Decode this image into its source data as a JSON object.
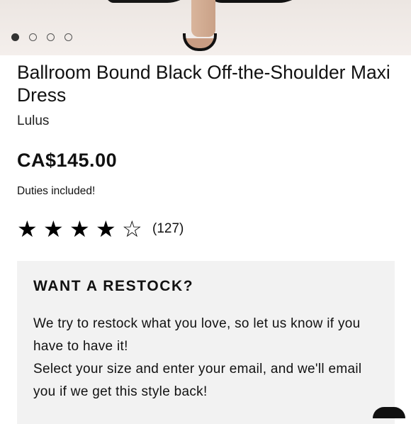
{
  "gallery": {
    "slides": [
      {
        "icon": "slide-dot-active"
      },
      {
        "icon": "slide-dot"
      },
      {
        "icon": "slide-dot"
      },
      {
        "icon": "slide-dot"
      }
    ],
    "active_index": 0
  },
  "product": {
    "title": "Ballroom Bound Black Off-the-Shoulder Maxi Dress",
    "brand": "Lulus",
    "price": "CA$145.00",
    "duties": "Duties included!",
    "rating": {
      "value": 4,
      "max": 5,
      "stars": [
        "★",
        "★",
        "★",
        "★",
        "☆"
      ],
      "count": "(127)"
    }
  },
  "restock": {
    "heading": "WANT A RESTOCK?",
    "paragraph1": "We try to restock what you love, so let us know if you have to have it!",
    "paragraph2": "Select your size and enter your email, and we'll email you if we get this style back!"
  },
  "colors": {
    "star": "#000000",
    "panel": "#f2f2f2",
    "text": "#111111"
  }
}
